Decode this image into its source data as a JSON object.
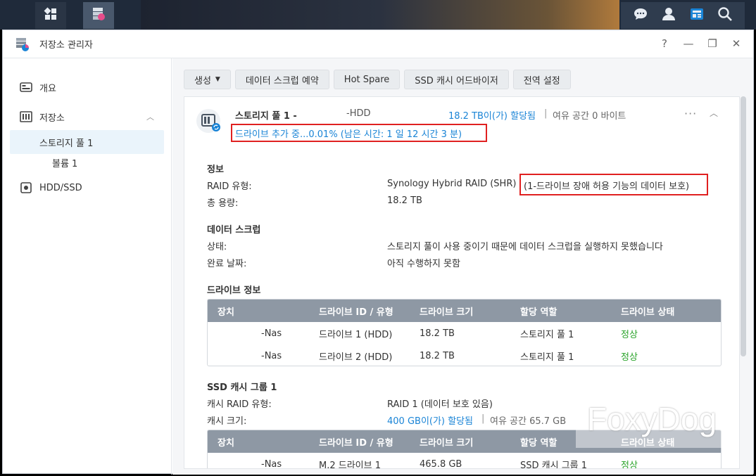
{
  "window": {
    "title": "저장소 관리자"
  },
  "window_controls": [
    "?",
    "—",
    "❐",
    "✕"
  ],
  "sidebar": {
    "items": [
      {
        "label": "개요"
      },
      {
        "label": "저장소"
      },
      {
        "label": "스토리지 풀 1"
      },
      {
        "label": "볼륨 1"
      },
      {
        "label": "HDD/SSD"
      }
    ]
  },
  "toolbar": {
    "create": "생성",
    "scrub_schedule": "데이터 스크럽 예약",
    "hot_spare": "Hot Spare",
    "ssd_advisor": "SSD 캐시 어드바이저",
    "global_settings": "전역 설정"
  },
  "pool": {
    "name": "스토리지 풀 1 -",
    "type": "-HDD",
    "allocated": "18.2 TB이(가) 할당됨",
    "separator": "|",
    "free": "여유 공간 0 바이트",
    "progress": "드라이브 추가 중...0.01% (남은 시간: 1 일 12 시간 3 분)"
  },
  "info": {
    "heading": "정보",
    "raid_label": "RAID 유형:",
    "raid_value": "Synology Hybrid RAID (SHR)",
    "raid_note": "(1-드라이브 장애 허용 기능의 데이터 보호)",
    "capacity_label": "총 용량:",
    "capacity_value": "18.2 TB"
  },
  "scrub": {
    "heading": "데이터 스크럽",
    "status_label": "상태:",
    "status_value": "스토리지 풀이 사용 중이기 때문에 데이터 스크럽을 실행하지 못했습니다",
    "done_label": "완료 날짜:",
    "done_value": "아직 수행하지 못함"
  },
  "drive_info": {
    "heading": "드라이브 정보",
    "columns": [
      "장치",
      "드라이브 ID / 유형",
      "드라이브 크기",
      "할당 역할",
      "드라이브 상태"
    ],
    "rows": [
      [
        "-Nas",
        "드라이브 1 (HDD)",
        "18.2 TB",
        "스토리지 풀 1",
        "정상"
      ],
      [
        "-Nas",
        "드라이브 2 (HDD)",
        "18.2 TB",
        "스토리지 풀 1",
        "정상"
      ]
    ]
  },
  "ssd_cache": {
    "heading": "SSD 캐시 그룹 1",
    "raid_label": "캐시 RAID 유형:",
    "raid_value": "RAID 1 (데이터 보호 있음)",
    "size_label": "캐시 크기:",
    "size_value": "400 GB이(가) 할당됨",
    "separator": "|",
    "size_free": "여유 공간 65.7 GB",
    "columns": [
      "장치",
      "드라이브 ID / 유형",
      "드라이브 크기",
      "할당 역할",
      "드라이브 상태"
    ],
    "rows": [
      [
        "-Nas",
        "M.2 드라이브 1",
        "465.8 GB",
        "SSD 캐시 그룹 1",
        "정상"
      ]
    ]
  },
  "watermark": "FoxyDog",
  "colors": {
    "accent": "#1a84d6",
    "ok": "#29a329",
    "highlight": "#e02020",
    "table_header": "#8e98a4"
  }
}
